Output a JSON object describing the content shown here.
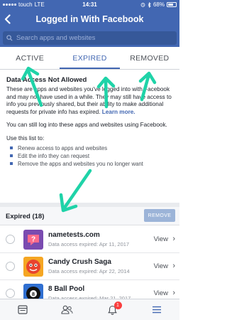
{
  "status_bar": {
    "carrier": "touch",
    "network": "LTE",
    "time": "14:31",
    "battery": "68%"
  },
  "nav": {
    "back_icon": "chevron-left-icon",
    "title": "Logged in With Facebook"
  },
  "search": {
    "placeholder": "Search apps and websites"
  },
  "tabs": [
    {
      "label": "ACTIVE"
    },
    {
      "label": "EXPIRED"
    },
    {
      "label": "REMOVED"
    }
  ],
  "info": {
    "heading": "Data Access Not Allowed",
    "paragraph1": "These are apps and websites you've logged into with Facebook and may not have used in a while. They may still have access to info you previously shared, but their ability to make additional requests for private info has expired.",
    "learn_more": "Learn more.",
    "paragraph2": "You can still log into these apps and websites using Facebook.",
    "use_list_title": "Use this list to:",
    "uses": [
      "Renew access to apps and websites",
      "Edit the info they can request",
      "Remove the apps and websites you no longer want"
    ]
  },
  "expired_section": {
    "label": "Expired (18)",
    "remove_button": "REMOVE"
  },
  "apps": [
    {
      "name": "nametests.com",
      "meta": "Data access expired: Apr 11, 2017",
      "view": "View"
    },
    {
      "name": "Candy Crush Saga",
      "meta": "Data access expired: Apr 22, 2014",
      "view": "View"
    },
    {
      "name": "8 Ball Pool",
      "meta": "Data access expired: Mar 21, 2017",
      "view": "View"
    }
  ],
  "bottom_bar": {
    "icons": [
      "news-feed-icon",
      "friends-icon",
      "notifications-icon",
      "menu-icon"
    ],
    "notification_count": "1"
  },
  "colors": {
    "brand": "#4267b2",
    "annotation": "#1fd3a8",
    "badge": "#fa3e3e"
  }
}
